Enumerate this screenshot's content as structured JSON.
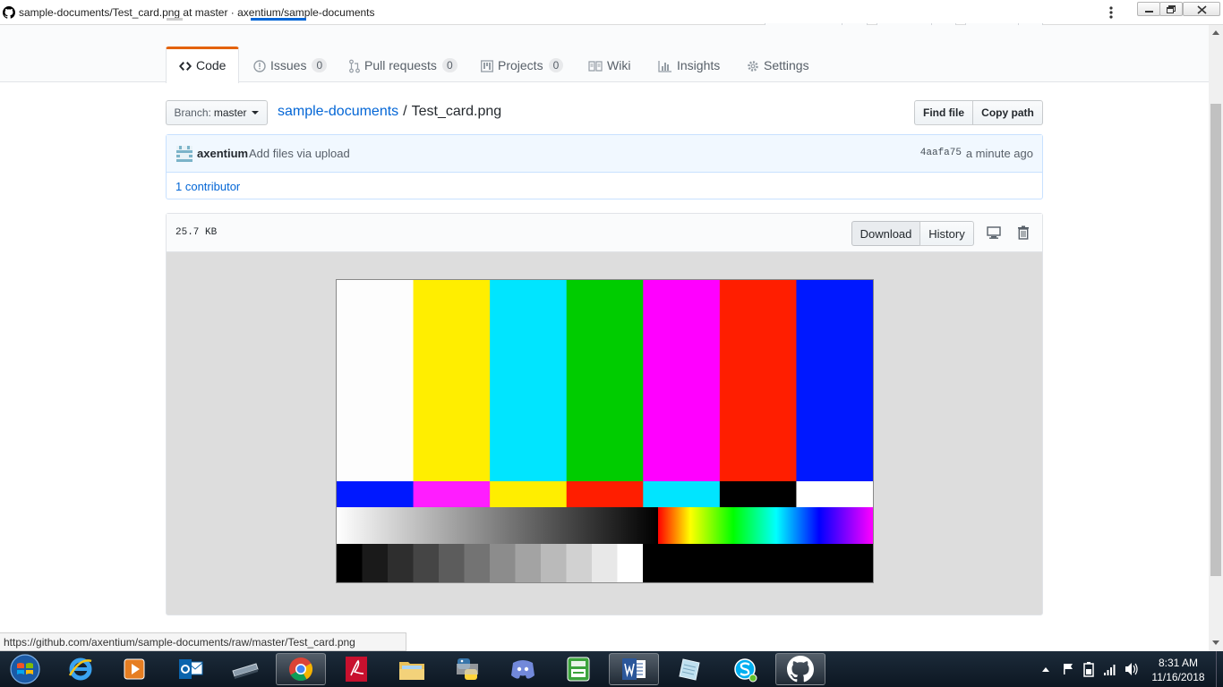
{
  "window": {
    "title": "sample-documents/Test_card.png at master · axentium/sample-documents"
  },
  "reponav": {
    "tabs": [
      {
        "label": "Code"
      },
      {
        "label": "Issues",
        "count": "0"
      },
      {
        "label": "Pull requests",
        "count": "0"
      },
      {
        "label": "Projects",
        "count": "0"
      },
      {
        "label": "Wiki"
      },
      {
        "label": "Insights"
      },
      {
        "label": "Settings"
      }
    ]
  },
  "filenav": {
    "branch_prefix": "Branch:",
    "branch": "master",
    "repo": "sample-documents",
    "separator": "/",
    "file": "Test_card.png",
    "find_file": "Find file",
    "copy_path": "Copy path"
  },
  "commit": {
    "author": "axentium",
    "message": "Add files via upload",
    "sha": "4aafa75",
    "when": "a minute ago",
    "contributors": "1 contributor"
  },
  "file": {
    "size": "25.7 KB",
    "download": "Download",
    "history": "History"
  },
  "image": {
    "top_bars": [
      "#fdfdfd",
      "#ffee00",
      "#00e5ff",
      "#00cc00",
      "#ff00ff",
      "#ff1e00",
      "#0018ff"
    ],
    "mid_bars": [
      "#0018ff",
      "#ff1dff",
      "#ffee00",
      "#ff1e00",
      "#00e5ff",
      "#000000",
      "#ffffff"
    ],
    "steps": [
      "#000000",
      "#1a1a1a",
      "#2e2e2e",
      "#454545",
      "#5c5c5c",
      "#737373",
      "#8c8c8c",
      "#a3a3a3",
      "#bababa",
      "#d1d1d1",
      "#e8e8e8",
      "#ffffff"
    ]
  },
  "statusbar": {
    "url": "https://github.com/axentium/sample-documents/raw/master/Test_card.png"
  },
  "taskbar": {
    "time": "8:31 AM",
    "date": "11/16/2018",
    "colors": {
      "accent": "#e36209",
      "link": "#0366d6"
    }
  }
}
